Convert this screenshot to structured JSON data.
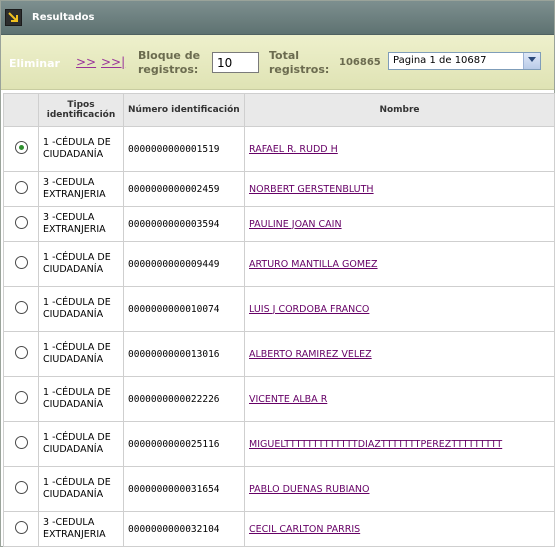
{
  "header": {
    "title": "Resultados",
    "icon": "arrow-down-right-icon"
  },
  "toolbar": {
    "eliminar": "Eliminar",
    "next": ">>",
    "last": ">>|",
    "block_label_1": "Bloque de",
    "block_label_2": "registros:",
    "block_value": "10",
    "total_label_1": "Total",
    "total_label_2": "registros:",
    "total_value": "106865",
    "page_select": "Pagina 1 de 10687"
  },
  "table": {
    "columns": [
      "",
      "Tipos identificación",
      "Número identificación",
      "Nombre"
    ],
    "rows": [
      {
        "tipo": "1 -CÉDULA DE CIUDADANÍA",
        "numero": "0000000000001519",
        "nombre": "RAFAEL R. RUDD H"
      },
      {
        "tipo": "3 -CEDULA EXTRANJERIA",
        "numero": "0000000000002459",
        "nombre": "NORBERT GERSTENBLUTH"
      },
      {
        "tipo": "3 -CEDULA EXTRANJERIA",
        "numero": "0000000000003594",
        "nombre": "PAULINE JOAN CAIN"
      },
      {
        "tipo": "1 -CÉDULA DE CIUDADANÍA",
        "numero": "0000000000009449",
        "nombre": "ARTURO MANTILLA GOMEZ"
      },
      {
        "tipo": "1 -CÉDULA DE CIUDADANÍA",
        "numero": "0000000000010074",
        "nombre": "LUIS J CORDOBA FRANCO"
      },
      {
        "tipo": "1 -CÉDULA DE CIUDADANÍA",
        "numero": "0000000000013016",
        "nombre": "ALBERTO RAMIREZ VELEZ"
      },
      {
        "tipo": "1 -CÉDULA DE CIUDADANÍA",
        "numero": "0000000000022226",
        "nombre": "VICENTE ALBA R"
      },
      {
        "tipo": "1 -CÉDULA DE CIUDADANÍA",
        "numero": "0000000000025116",
        "nombre": "MIGUELTTTTTTTTTTTTTDIAZTTTTTTTPEREZTTTTTTTTT"
      },
      {
        "tipo": "1 -CÉDULA DE CIUDADANÍA",
        "numero": "0000000000031654",
        "nombre": "PABLO DUENAS RUBIANO"
      },
      {
        "tipo": "3 -CEDULA EXTRANJERIA",
        "numero": "0000000000032104",
        "nombre": "CECIL CARLTON PARRIS"
      }
    ],
    "selected_index": 0
  }
}
